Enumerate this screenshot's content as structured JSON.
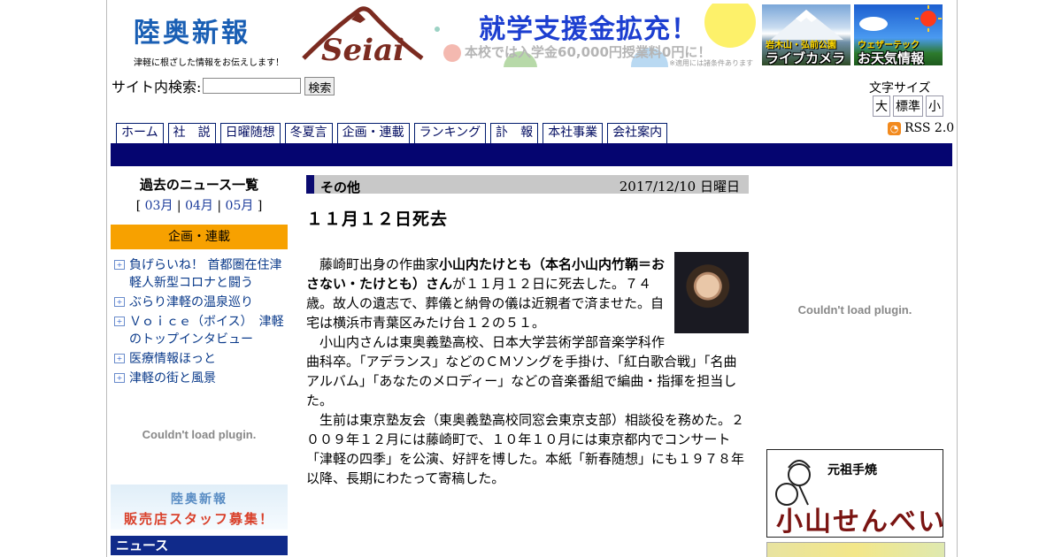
{
  "header": {
    "site_title": "陸奥新報",
    "tagline": "津軽に根ざした情報をお伝えします！",
    "seiai_logo": "Seiai",
    "banner_main": "就学支援金拡充！",
    "banner_sub": "本校では入学金60,000円授業料0円に！",
    "banner_note": "※適用には諸条件あります",
    "live_cam_top": "岩木山・弘前公園",
    "live_cam_bottom": "ライブカメラ",
    "weather_top": "ウェザーテック",
    "weather_bottom": "お天気情報"
  },
  "search": {
    "label": "サイト内検索:",
    "button": "検索",
    "value": ""
  },
  "font_size": {
    "label": "文字サイズ",
    "large": "大",
    "standard": "標準",
    "small": "小"
  },
  "rss": {
    "icon": "rss-icon",
    "label": "RSS 2.0"
  },
  "nav": [
    "ホーム",
    "社　説",
    "日曜随想",
    "冬夏言",
    "企画・連載",
    "ランキング",
    "訃　報",
    "本社事業",
    "会社案内"
  ],
  "left": {
    "past_title": "過去のニュース一覧",
    "months": [
      "03月",
      "04月",
      "05月"
    ],
    "kikaku_title": "企画・連載",
    "links": [
      "負げらいね！ 首都圏在住津軽人新型コロナと闘う",
      "ぶらり津軽の温泉巡り",
      "Ｖｏｉｃｅ（ボイス）　津軽のトップインタビュー",
      "医療情報ほっと",
      "津軽の街と風景"
    ],
    "plugin_msg": "Couldn't load plugin.",
    "recruit_line1": "陸奥新報",
    "recruit_line2": "販売店スタッフ募集！",
    "news_head": "ニュース"
  },
  "article": {
    "category": "その他",
    "date": "2017/12/10 日曜日",
    "title": "１１月１２日死去",
    "p1_pre": "藤崎町出身の作曲家",
    "p1_bold": "小山内たけとも（本名小山内竹鞆＝おさない・たけとも）さん",
    "p1_post": "が１１月１２日に死去した。７４歳。故人の遺志で、葬儀と納骨の儀は近親者で済ませた。自宅は横浜市青葉区みたけ台１２の５１。",
    "p2": "小山内さんは東奥義塾高校、日本大学芸術学部音楽学科作曲科卒。「アデランス」などのＣＭソングを手掛け、「紅白歌合戦」「名曲アルバム」「あなたのメロディー」などの音楽番組で編曲・指揮を担当した。",
    "p3": "生前は東京塾友会（東奥義塾高校同窓会東京支部）相談役を務めた。２００９年１２月には藤崎町で、１０年１０月には東京都内でコンサート「津軽の四季」を公演、好評を博した。本紙「新春随想」にも１９７８年以降、長期にわたって寄稿した。"
  },
  "right": {
    "plugin_msg": "Couldn't load plugin.",
    "ad_label": "元祖手焼",
    "ad_brand": "小山せんべい"
  },
  "colors": {
    "navbar": "#050570",
    "kikaku": "#f7a100",
    "news_head": "#102a8a",
    "logo_blue": "#1a5fb4"
  }
}
